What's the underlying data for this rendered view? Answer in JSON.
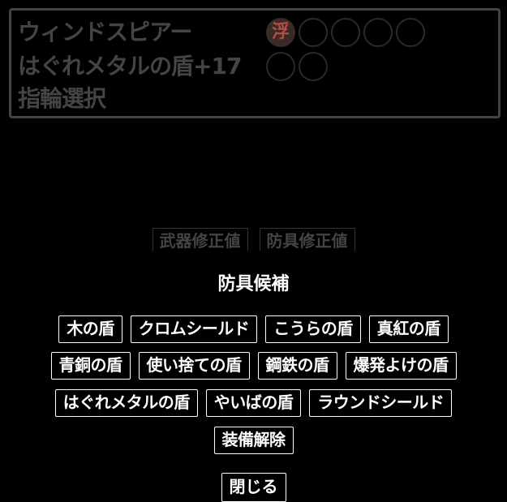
{
  "status": {
    "weapon_name": "ウィンドスピアー",
    "armor_name": "はぐれメタルの盾+17",
    "ring_select": "指輪選択",
    "slot_badge": "浮"
  },
  "tabs": [
    {
      "label": "武器修正値"
    },
    {
      "label": "防具修正値"
    }
  ],
  "modal": {
    "title": "防具候補",
    "options": [
      "木の盾",
      "クロムシールド",
      "こうらの盾",
      "真紅の盾",
      "青銅の盾",
      "使い捨ての盾",
      "鋼鉄の盾",
      "爆発よけの盾",
      "はぐれメタルの盾",
      "やいばの盾",
      "ラウンドシールド",
      "装備解除"
    ],
    "close_label": "閉じる"
  },
  "colors": {
    "background": "#000000",
    "text": "#ffffff",
    "dimmed": "#444444",
    "badge": "#b05045"
  }
}
